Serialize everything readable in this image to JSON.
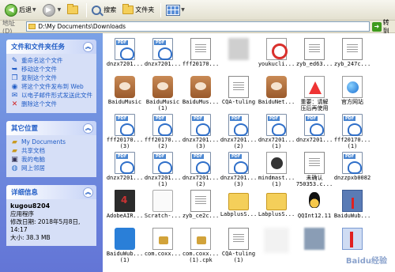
{
  "toolbar": {
    "back_label": "后退",
    "search_label": "搜索",
    "folders_label": "文件夹"
  },
  "address": {
    "label": "地址(D)",
    "path": "D:\\My Documents\\Downloads",
    "go_label": "转到"
  },
  "tasks_pane": {
    "title": "文件和文件夹任务",
    "items": [
      "重命名这个文件",
      "移动这个文件",
      "复制这个文件",
      "将这个文件发布到 Web",
      "以电子邮件形式发送此文件",
      "删除这个文件"
    ]
  },
  "places_pane": {
    "title": "其它位置",
    "items": [
      "My Documents",
      "共享文档",
      "我的电脑",
      "网上邻居"
    ]
  },
  "details_pane": {
    "title": "详细信息",
    "name": "kugou8204",
    "type": "应用程序",
    "modified": "修改日期: 2018年5月8日, 14:17",
    "size": "大小: 38.3 MB"
  },
  "files": [
    {
      "label": "dnzx7201...",
      "icon": "pdf"
    },
    {
      "label": "dnzx7201...",
      "icon": "pdf"
    },
    {
      "label": "fff20170...",
      "icon": "doc"
    },
    {
      "label": "",
      "icon": "blur"
    },
    {
      "label": "youkucli...",
      "icon": "red"
    },
    {
      "label": "zyb_ed63...",
      "icon": "doc"
    },
    {
      "label": "zyb_247c...",
      "icon": "doc"
    },
    {
      "label": "BaiduMusic",
      "icon": "baidu"
    },
    {
      "label": "BaiduMusic\n(1)",
      "icon": "baidu"
    },
    {
      "label": "BaiduMus...",
      "icon": "baidu"
    },
    {
      "label": "CQA-tuling",
      "icon": "doc"
    },
    {
      "label": "BaiduNet...",
      "icon": "baidu"
    },
    {
      "label": "重要：请解\n压后再使用",
      "icon": "warn"
    },
    {
      "label": "官方网站",
      "icon": "globe"
    },
    {
      "label": "fff20170...\n(3)",
      "icon": "pdf"
    },
    {
      "label": "fff20170...\n(2)",
      "icon": "pdf"
    },
    {
      "label": "dnzx7201...\n(3)",
      "icon": "pdf"
    },
    {
      "label": "dnzx7201...\n(2)",
      "icon": "pdf"
    },
    {
      "label": "dnzx7201...\n(1)",
      "icon": "pdf"
    },
    {
      "label": "dnzx7201...",
      "icon": "pdf"
    },
    {
      "label": "fff20170...\n(1)",
      "icon": "pdf"
    },
    {
      "label": "dnzx7201...",
      "icon": "pdf"
    },
    {
      "label": "dnzx7201...\n(1)",
      "icon": "pdf"
    },
    {
      "label": "dnzx7201...\n(2)",
      "icon": "pdf"
    },
    {
      "label": "dnzx7201...\n(3)",
      "icon": "pdf"
    },
    {
      "label": "mindmast...\n(1)",
      "icon": "mind"
    },
    {
      "label": "未确认\n750353.c...",
      "icon": "doc"
    },
    {
      "label": "dnzzpxb0082",
      "icon": "pdf"
    },
    {
      "label": "AdobeAIR...",
      "icon": "dark"
    },
    {
      "label": "Scratch-...",
      "icon": "scratch"
    },
    {
      "label": "zyb_ce2c...",
      "icon": "doc"
    },
    {
      "label": "LabplusS...",
      "icon": "folder"
    },
    {
      "label": "LabplusS...",
      "icon": "folder"
    },
    {
      "label": "QQInt12.11",
      "icon": "qq"
    },
    {
      "label": "BaiduWub...",
      "icon": "cube"
    },
    {
      "label": "BaiduWub...\n(1)",
      "icon": "blue"
    },
    {
      "label": "com.coxx...",
      "icon": "lock"
    },
    {
      "label": "com.coxx...\n(1).cpk",
      "icon": "lock"
    },
    {
      "label": "CQA-tuling\n(1)",
      "icon": "doc"
    },
    {
      "label": "",
      "icon": "blurpatch"
    },
    {
      "label": "",
      "icon": "gray"
    },
    {
      "label": "",
      "icon": "selected"
    }
  ],
  "watermark": "Baidu经验"
}
